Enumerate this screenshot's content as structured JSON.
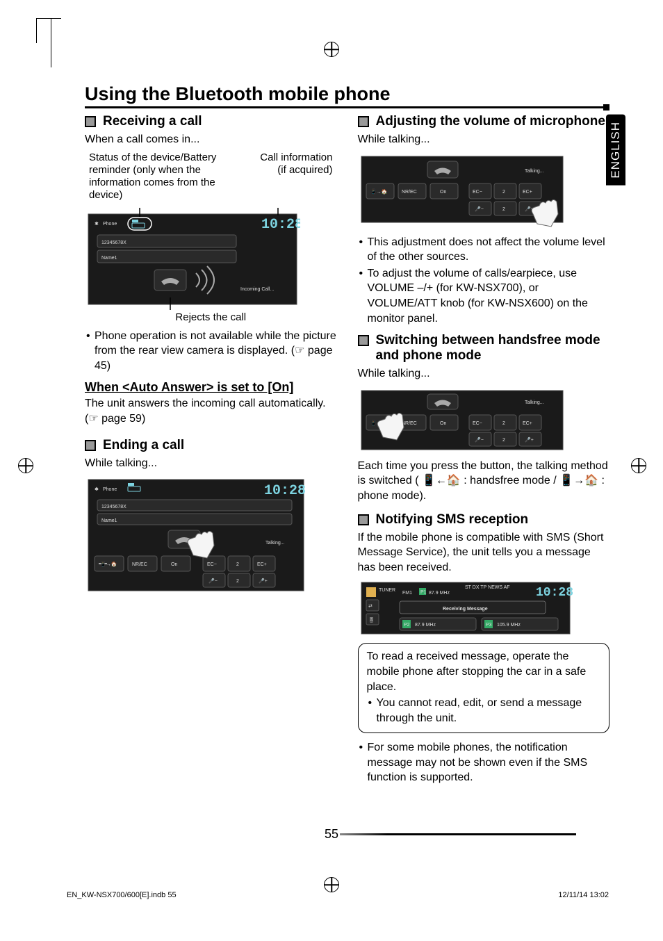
{
  "page": {
    "number": "55",
    "language_tab": "ENGLISH",
    "footer_left": "EN_KW-NSX700/600[E].indb   55",
    "footer_right": "12/11/14   13:02"
  },
  "title": "Using the Bluetooth mobile phone",
  "left": {
    "h_receiving": "Receiving a call",
    "when_call": "When a call comes in...",
    "annot_status": "Status of the device/Battery reminder (only when the information comes from the device)",
    "annot_callinfo": "Call information (if acquired)",
    "fig1": {
      "phone_label": "Phone",
      "clock": "10:28",
      "number_text": "12345678X",
      "name_text": "Name1",
      "status_text": "Incoming Call..."
    },
    "fig1_caption": "Rejects the call",
    "bullet_phone_op": "Phone operation is not available while the picture from the rear view camera is displayed. (☞ page 45)",
    "auto_answer_title": "When <Auto Answer> is set to [On]",
    "auto_answer_body": "The unit answers the incoming call automatically. (☞ page 59)",
    "h_ending": "Ending a call",
    "while_talking": "While talking...",
    "fig2": {
      "phone_label": "Phone",
      "clock": "10:28",
      "number_text": "12345678X",
      "name_text": "Name1",
      "status_text": "Talking...",
      "btn_nrec": "NR/EC",
      "btn_on": "On",
      "ec_minus": "EC−",
      "ec_plus": "EC+",
      "val": "2"
    }
  },
  "right": {
    "h_adjusting": "Adjusting the volume of microphone",
    "while_talking": "While talking...",
    "fig3": {
      "btn_nrec": "NR/EC",
      "btn_on": "On",
      "ec_minus": "EC−",
      "ec_plus": "EC+",
      "val": "2",
      "status_text": "Talking..."
    },
    "bul_adj1": "This adjustment does not affect the volume level of the other sources.",
    "bul_adj2": "To adjust the volume of calls/earpiece, use VOLUME –/+ (for KW-NSX700), or VOLUME/ATT knob (for KW-NSX600) on the monitor panel.",
    "h_switching": "Switching between handsfree mode and phone mode",
    "while_talking2": "While talking...",
    "fig4": {
      "btn_nrec": "NR/EC",
      "btn_on": "On",
      "ec_minus": "EC−",
      "ec_plus": "EC+",
      "val": "2",
      "status_text": "Talking..."
    },
    "switch_body_pre": "Each time you press the button, the talking method is switched (",
    "switch_body_mid": " : handsfree mode / ",
    "switch_body_post": " : phone mode).",
    "h_sms": "Notifying SMS reception",
    "sms_body": "If the mobile phone is compatible with SMS (Short Message Service), the unit tells you a message has been received.",
    "fig5": {
      "tuner": "TUNER",
      "band": "FM1",
      "freq_small": "87.9 MHz",
      "indicators": "ST   DX   TP  NEWS  AF",
      "clock": "10:28",
      "msg": "Receiving Message",
      "preset2": "87.9 MHz",
      "preset3": "105.9 MHz"
    },
    "note_p": "To read a received message, operate the mobile phone after stopping the car in a safe place.",
    "note_b": "You cannot read, edit, or send a message through the unit.",
    "bul_sms": "For some mobile phones, the notification message may not be shown even if the SMS function is supported."
  },
  "chart_data": {
    "type": "table",
    "description": "UI screenshots embedded in manual page – values shown on simulated device screens",
    "screens": [
      {
        "id": "incoming_call",
        "clock": "10:28",
        "number": "12345678X",
        "name": "Name1",
        "status": "Incoming Call..."
      },
      {
        "id": "talking_end_call",
        "clock": "10:28",
        "number": "12345678X",
        "name": "Name1",
        "status": "Talking...",
        "ec_value": 2,
        "mic_value": 2,
        "buttons": [
          "NR/EC",
          "On",
          "EC−",
          "EC+"
        ]
      },
      {
        "id": "mic_volume",
        "status": "Talking...",
        "ec_value": 2,
        "mic_value": 2,
        "buttons": [
          "NR/EC",
          "On",
          "EC−",
          "EC+"
        ]
      },
      {
        "id": "mode_switch",
        "status": "Talking...",
        "ec_value": 2,
        "mic_value": 2,
        "buttons": [
          "NR/EC",
          "On",
          "EC−",
          "EC+"
        ]
      },
      {
        "id": "sms_tuner",
        "clock": "10:28",
        "band": "FM1",
        "freq": "87.9 MHz",
        "banner": "Receiving Message",
        "presets": [
          "87.9 MHz",
          "105.9 MHz"
        ]
      }
    ]
  }
}
